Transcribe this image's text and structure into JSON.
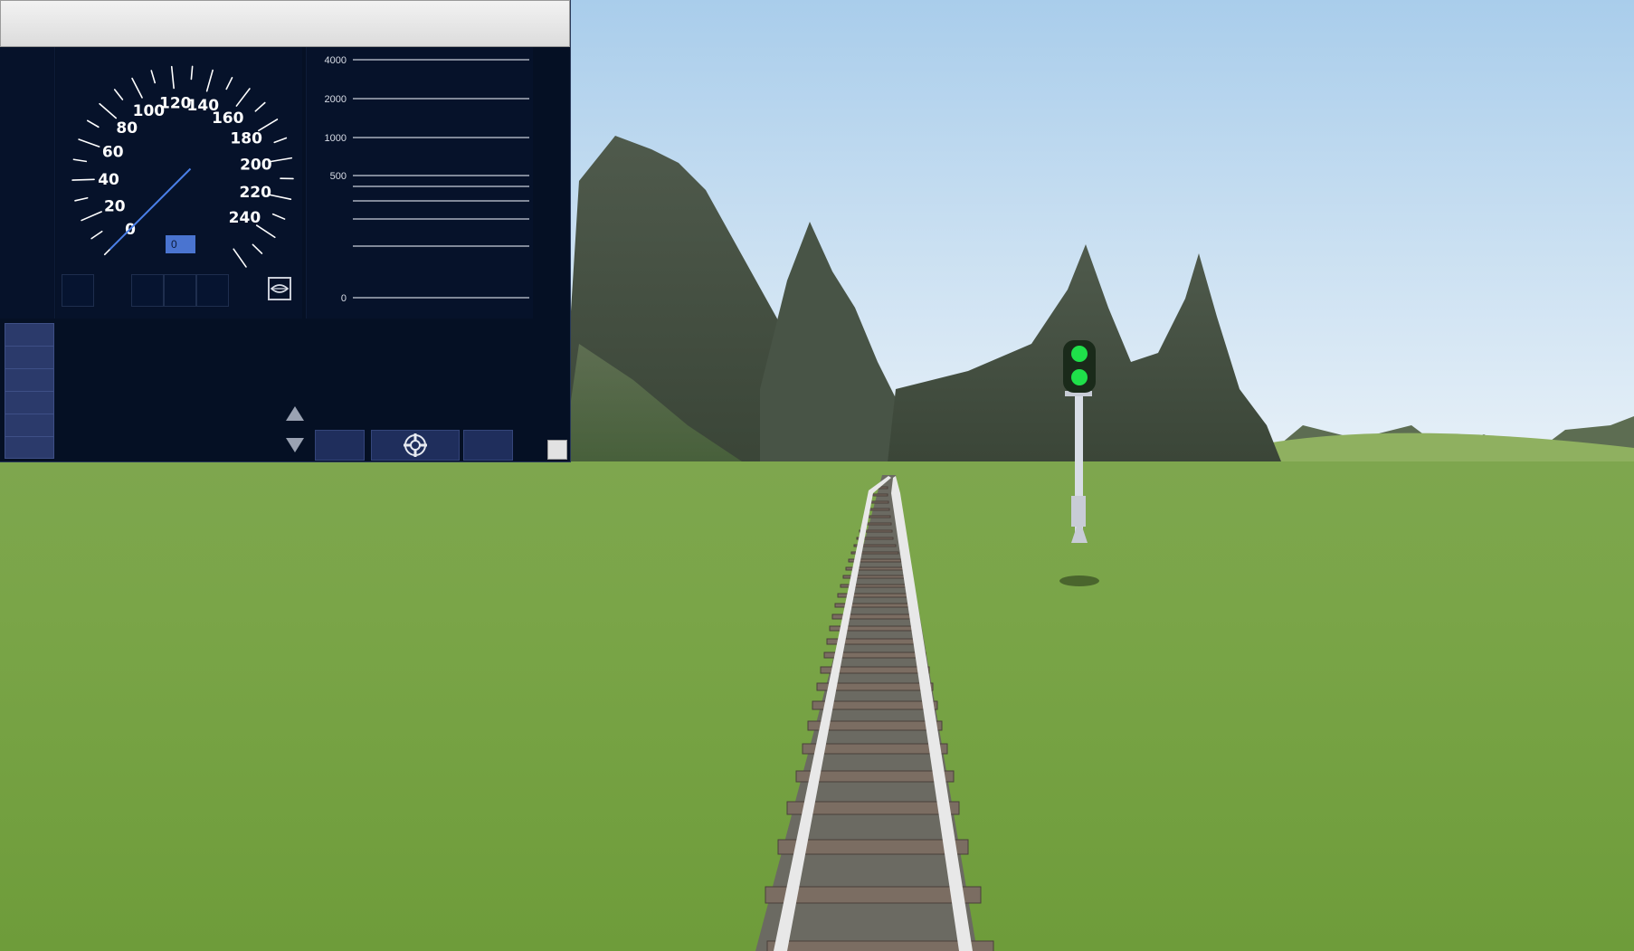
{
  "speedometer": {
    "scale_labels": [
      "0",
      "20",
      "40",
      "60",
      "80",
      "100",
      "120",
      "140",
      "160",
      "180",
      "200",
      "220",
      "240"
    ],
    "current_speed": "0",
    "current_speed_value": 0,
    "needle_color": "#4a7fe8"
  },
  "distance_bar": {
    "labels": [
      "4000",
      "2000",
      "1000",
      "500",
      "0"
    ]
  },
  "controls": {
    "mode_icon": "eye-icon",
    "scroll_up_icon": "arrow-up-icon",
    "scroll_down_icon": "arrow-down-icon",
    "settings_icon": "crosshair-wheel-icon"
  },
  "scene": {
    "signal_aspect": "green",
    "signal_color": "#1fe04a"
  }
}
